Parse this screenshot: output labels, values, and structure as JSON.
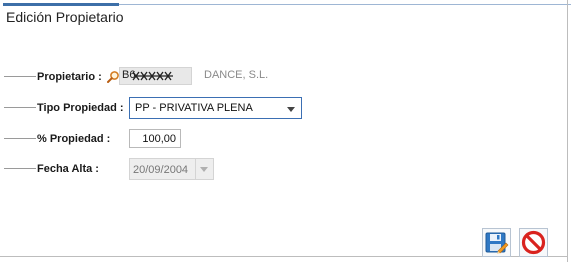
{
  "window": {
    "title": "Edición Propietario"
  },
  "form": {
    "propietario": {
      "label": "Propietario :",
      "code": "B6",
      "name": "DANCE, S.L."
    },
    "tipo_propiedad": {
      "label": "Tipo Propiedad :",
      "value": "PP - PRIVATIVA PLENA"
    },
    "porcentaje": {
      "label": "% Propiedad :",
      "value": "100,00"
    },
    "fecha_alta": {
      "label": "Fecha Alta :",
      "value": "20/09/2004"
    }
  },
  "icons": {
    "lookup": "magnifier-icon",
    "save": "save-icon",
    "cancel": "cancel-icon"
  },
  "colors": {
    "accent": "#3d6fa8",
    "focus_border": "#3b6fb3",
    "cancel_red": "#d9231f"
  }
}
